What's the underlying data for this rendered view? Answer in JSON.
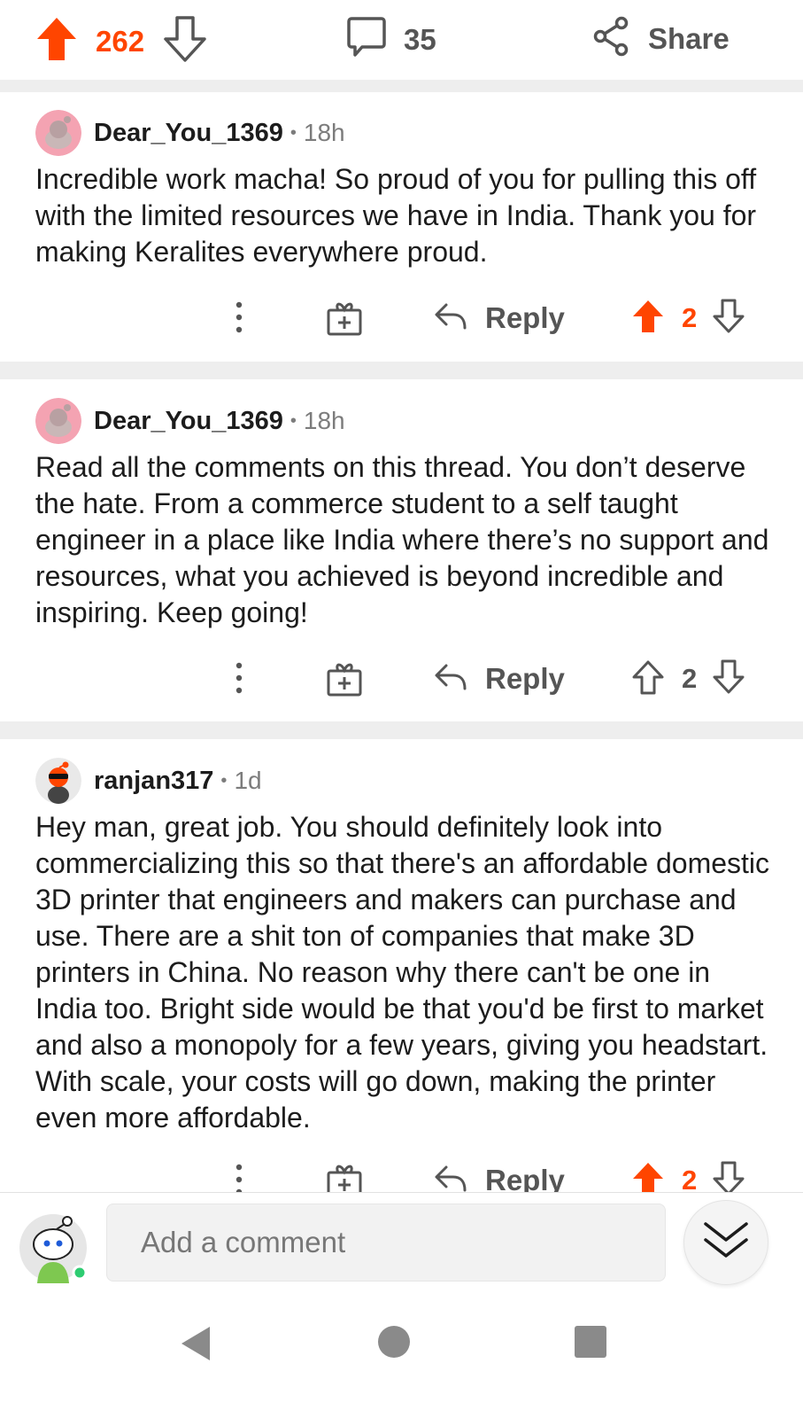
{
  "post": {
    "vote_count": "262",
    "comment_count": "35",
    "share_label": "Share"
  },
  "comments": [
    {
      "username": "Dear_You_1369",
      "time": "18h",
      "body": "Incredible work macha! So proud of you for pulling this off with the limited resources we have in India. Thank you for making Keralites everywhere proud.",
      "reply_label": "Reply",
      "votes": "2",
      "upvoted": true
    },
    {
      "username": "Dear_You_1369",
      "time": "18h",
      "body": "Read all the comments on this thread. You don’t deserve the hate. From a commerce student to a self taught engineer in a place like India where there’s no support and resources, what you achieved is beyond incredible and inspiring. Keep going!",
      "reply_label": "Reply",
      "votes": "2",
      "upvoted": false
    },
    {
      "username": "ranjan317",
      "time": "1d",
      "body": "Hey man, great job. You should definitely look into commercializing this so that there's an affordable domestic 3D printer that engineers and makers can purchase and use. There are a shit ton of companies that make 3D printers in China. No reason why there can't be one in India too. Bright side would be that you'd be first to market and also a monopoly for a few years, giving you  headstart. With scale, your costs will go down, making the printer even more affordable.",
      "reply_label": "Reply",
      "votes": "2",
      "upvoted": true
    }
  ],
  "composer": {
    "placeholder": "Add a comment"
  },
  "colors": {
    "upvote": "#ff4500",
    "icon_gray": "#555555",
    "separator": "#eeeeee"
  },
  "icons": [
    "upvote-icon",
    "downvote-icon",
    "comment-icon",
    "share-icon",
    "more-icon",
    "award-icon",
    "reply-icon",
    "double-chevron-down-icon",
    "back-icon",
    "home-icon",
    "recents-icon"
  ]
}
